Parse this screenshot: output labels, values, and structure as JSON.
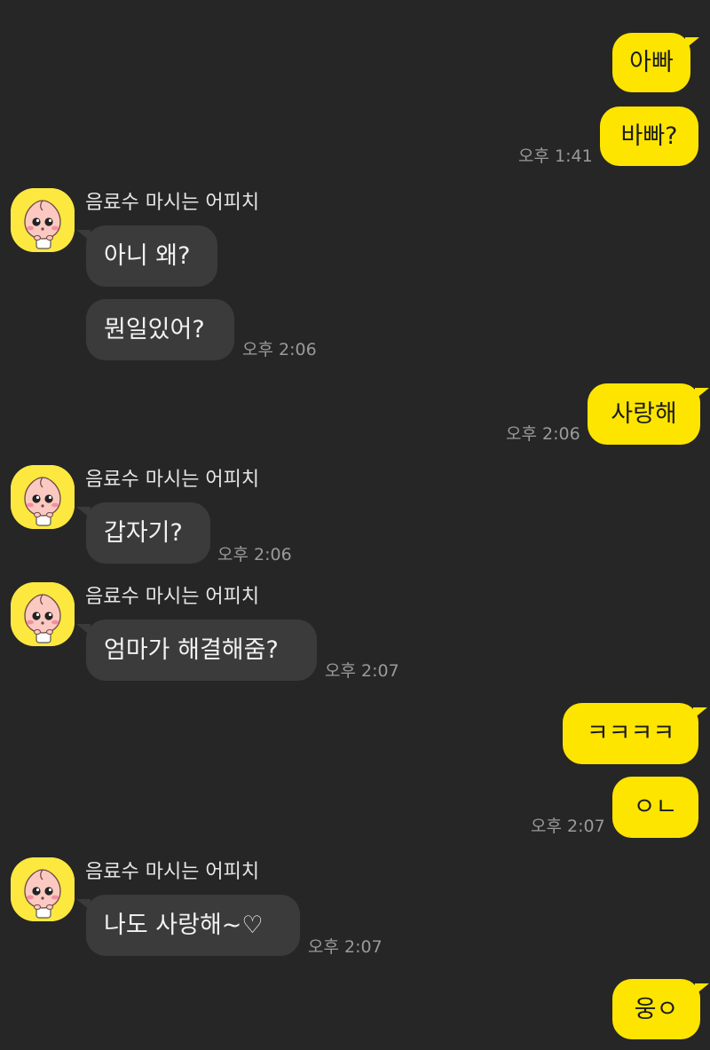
{
  "colors": {
    "background": "#262626",
    "my_bubble": "#fee500",
    "their_bubble": "#3b3b3b",
    "timestamp": "#9a9a9a"
  },
  "contact": {
    "name": "음료수 마시는 어피치",
    "avatar_icon": "apeach-avatar-icon"
  },
  "messages": [
    {
      "from": "me",
      "text": "아빠"
    },
    {
      "from": "me",
      "text": "바빠?",
      "time": "오후 1:41"
    },
    {
      "from": "them",
      "sender": "음료수 마시는 어피치",
      "text": "아니 왜?"
    },
    {
      "from": "them",
      "text": "뭔일있어?",
      "time": "오후 2:06"
    },
    {
      "from": "me",
      "text": "사랑해",
      "time": "오후 2:06"
    },
    {
      "from": "them",
      "sender": "음료수 마시는 어피치",
      "text": "갑자기?",
      "time": "오후 2:06"
    },
    {
      "from": "them",
      "sender": "음료수 마시는 어피치",
      "text": "엄마가 해결해줌?",
      "time": "오후 2:07"
    },
    {
      "from": "me",
      "text": "ㅋㅋㅋㅋ"
    },
    {
      "from": "me",
      "text": "ㅇㄴ",
      "time": "오후 2:07"
    },
    {
      "from": "them",
      "sender": "음료수 마시는 어피치",
      "text": "나도 사랑해~♡",
      "time": "오후 2:07"
    },
    {
      "from": "me",
      "text": "웅ㅇ"
    }
  ]
}
